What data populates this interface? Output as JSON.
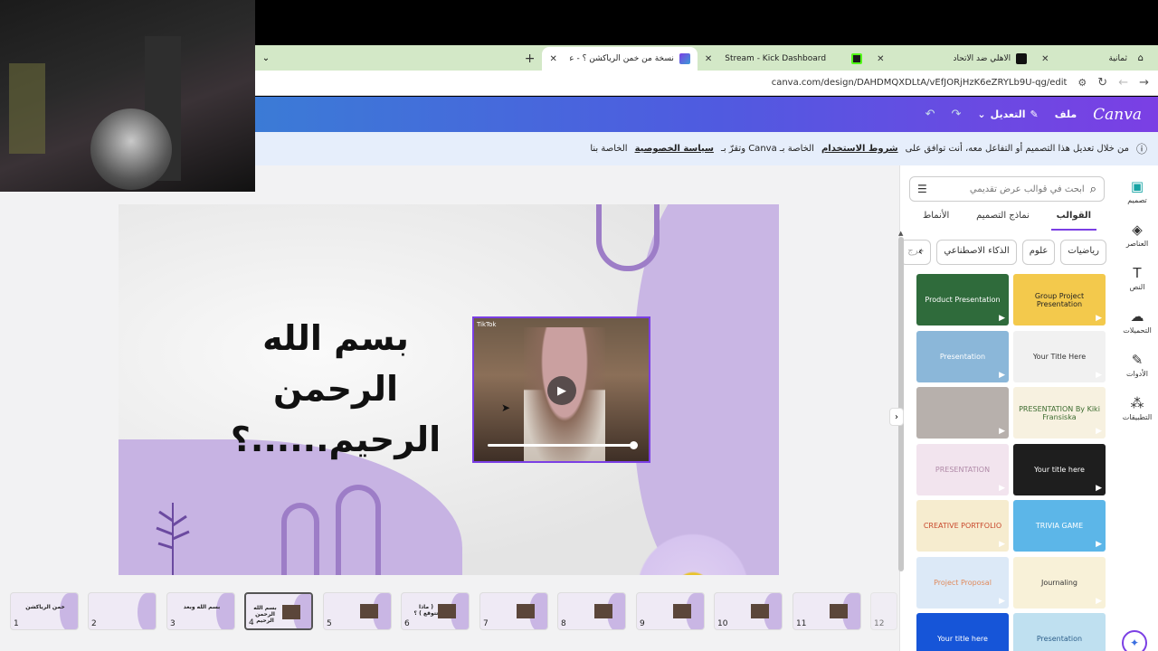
{
  "browser": {
    "tabs": [
      {
        "label": "ثمانية",
        "active": false
      },
      {
        "label": "الأهلي ضد الاتحاد",
        "active": false
      },
      {
        "label": "Stream - Kick Dashboard",
        "active": false
      },
      {
        "label": "نسخة من خمن الرياكشن ؟ - عرض…",
        "active": true
      }
    ],
    "new_tab": "+",
    "url": "canva.com/design/DAHDMQXDLtA/vEfJORjHzK6eZRYLb9U-qg/edit"
  },
  "canva_header": {
    "logo": "Canva",
    "file_label": "ملف",
    "edit_label": "التعديل"
  },
  "notice": {
    "text_a": "من خلال تعديل هذا التصميم أو التفاعل معه، أنت توافق على",
    "terms_link": "شروط الاستخدام",
    "text_b": "الخاصة بـ Canva وتقرّ بـ",
    "privacy_link": "سياسة الخصوصية",
    "text_c": "الخاصة بنا"
  },
  "rail": [
    {
      "label": "تصميم",
      "icon": "design-icon",
      "active": true
    },
    {
      "label": "العناصر",
      "icon": "elements-icon",
      "active": false
    },
    {
      "label": "النص",
      "icon": "text-icon",
      "active": false
    },
    {
      "label": "التحميلات",
      "icon": "upload-icon",
      "active": false
    },
    {
      "label": "الأدوات",
      "icon": "tools-icon",
      "active": false
    },
    {
      "label": "التطبيقات",
      "icon": "apps-icon",
      "active": false
    }
  ],
  "panel": {
    "search_placeholder": "ابحث في قوالب عرض تقديمي",
    "tabs": [
      "القوالب",
      "نماذج التصميم",
      "الأنماط"
    ],
    "chips": [
      "رياضيات",
      "علوم",
      "الذكاء الاصطناعي",
      "خرج"
    ],
    "templates": [
      {
        "label": "Group Project Presentation",
        "bg": "#f3c94c",
        "color": "#222"
      },
      {
        "label": "Product Presentation",
        "bg": "#2f6b3b",
        "color": "#fff"
      },
      {
        "label": "Your Title Here",
        "bg": "#f1f1f1",
        "color": "#333"
      },
      {
        "label": "Presentation",
        "bg": "#8bb7d9",
        "color": "#fff"
      },
      {
        "label": "PRESENTATION By Kiki Fransiska",
        "bg": "#f7f1e0",
        "color": "#3c6b2f"
      },
      {
        "label": "",
        "bg": "#b7b0ac",
        "color": "#fff"
      },
      {
        "label": "Your title here",
        "bg": "#1e1e1e",
        "color": "#fff"
      },
      {
        "label": "PRESENTATION",
        "bg": "#f2e4ee",
        "color": "#b08aa8"
      },
      {
        "label": "TRIVIA GAME",
        "bg": "#5cb6e8",
        "color": "#fff"
      },
      {
        "label": "CREATIVE PORTFOLIO",
        "bg": "#f6eccf",
        "color": "#c8482c"
      },
      {
        "label": "Journaling",
        "bg": "#f8f1d8",
        "color": "#333"
      },
      {
        "label": "Project Proposal",
        "bg": "#dce9f7",
        "color": "#e08a5c"
      },
      {
        "label": "Presentation",
        "bg": "#bfe0f0",
        "color": "#2d5f8a"
      },
      {
        "label": "Your title here",
        "bg": "#1655d8",
        "color": "#fff"
      }
    ]
  },
  "slide": {
    "title_lines": [
      "بسم الله",
      "الرحمن",
      "الرحيم......؟"
    ],
    "video_source": "TikTok"
  },
  "filmstrip": [
    {
      "num": "1",
      "text": "خمن الرياكشن"
    },
    {
      "num": "2",
      "text": ""
    },
    {
      "num": "3",
      "text": "بسم الله وبعد"
    },
    {
      "num": "4",
      "text": "بسم الله الرحمن الرحيم"
    },
    {
      "num": "5",
      "text": ""
    },
    {
      "num": "6",
      "text": "( ماذا تتوقع ) ؟"
    },
    {
      "num": "7",
      "text": ""
    },
    {
      "num": "8",
      "text": ""
    },
    {
      "num": "9",
      "text": ""
    },
    {
      "num": "10",
      "text": ""
    },
    {
      "num": "11",
      "text": ""
    },
    {
      "num": "12",
      "text": ""
    }
  ]
}
